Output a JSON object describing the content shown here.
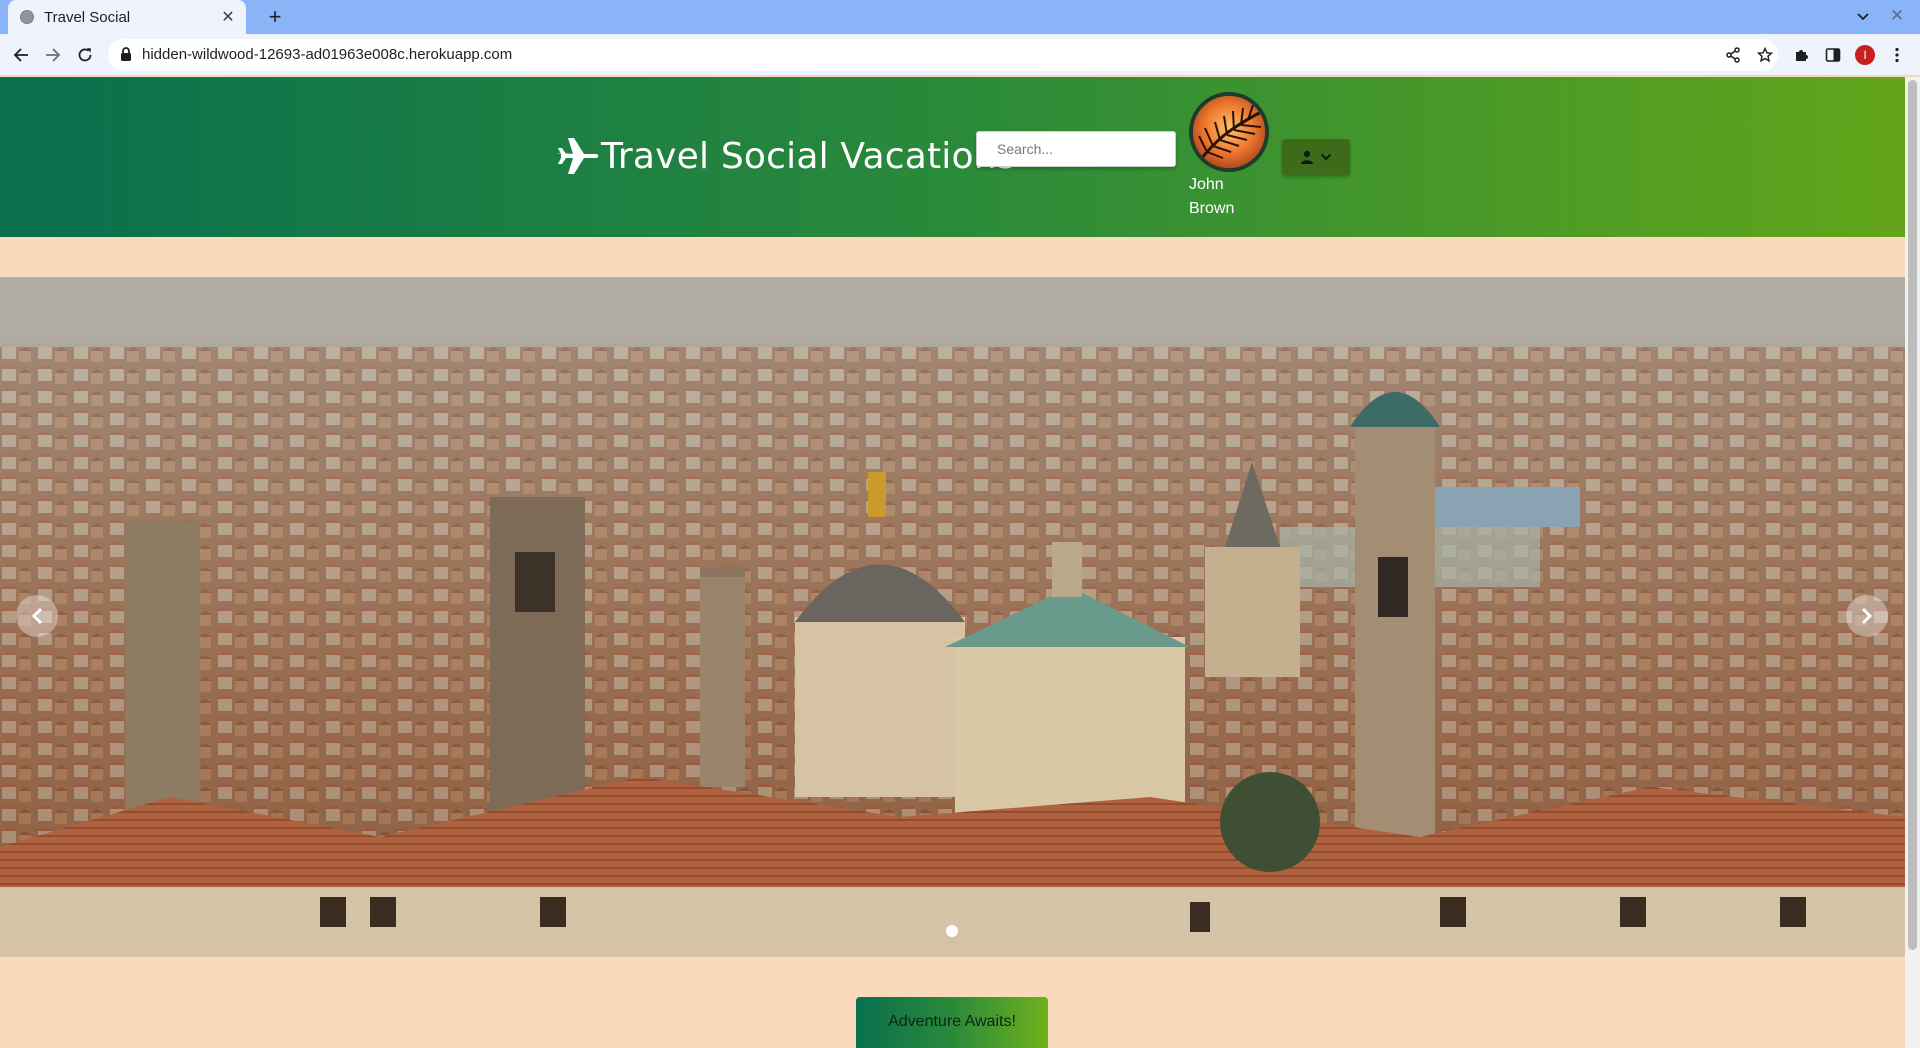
{
  "browser": {
    "tab_title": "Travel Social",
    "url": "hidden-wildwood-12693-ad01963e008c.herokuapp.com",
    "profile_initial": "I"
  },
  "header": {
    "brand_icon": "plane-icon",
    "brand_title": "Travel Social Vacations",
    "search_placeholder": "Search...",
    "user_name": "John Brown",
    "user_menu_icon": "user-icon"
  },
  "carousel": {
    "slide_alt": "Bergamo old town skyline",
    "active_index": 0,
    "slide_count": 1
  },
  "cta": {
    "label": "Adventure Awaits!"
  },
  "colors": {
    "header_start": "#096f4f",
    "header_end": "#63a51a",
    "page_bg": "#fbd9bd",
    "tab_strip": "#8ab4f8"
  }
}
